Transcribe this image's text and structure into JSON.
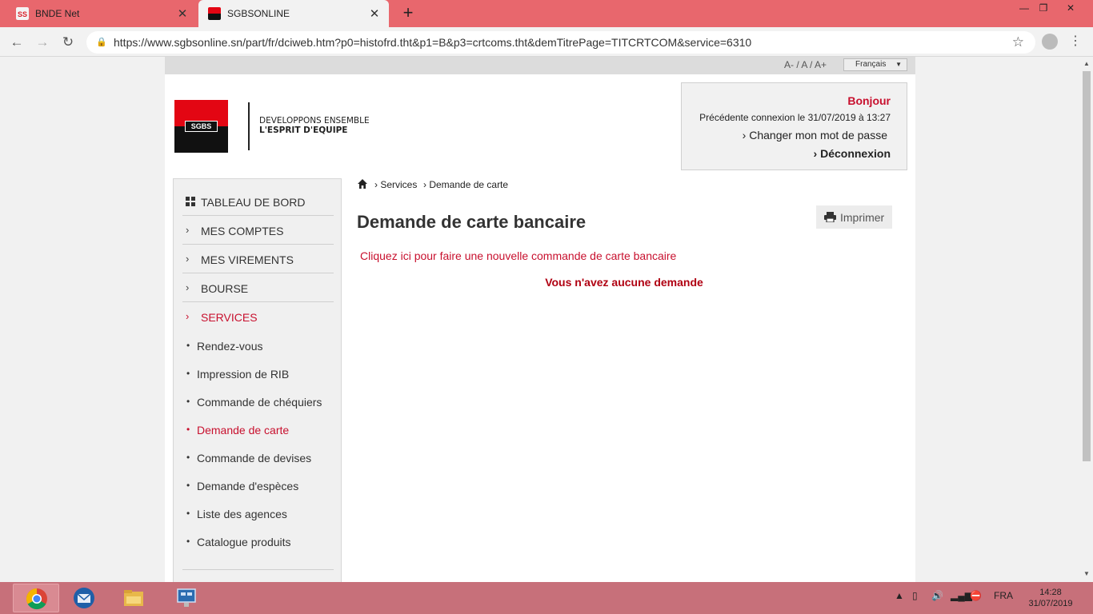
{
  "browser": {
    "tabs": [
      {
        "title": "BNDE Net",
        "icon": "bnde-favicon",
        "active": false
      },
      {
        "title": "SGBSONLINE",
        "icon": "sgbs-favicon",
        "active": true
      }
    ],
    "url": "https://www.sgbsonline.sn/part/fr/dciweb.htm?p0=histofrd.tht&p1=B&p3=crtcoms.tht&demTitrePage=TITCRTCOM&service=6310"
  },
  "header": {
    "font_size_controls": "A- / A / A+",
    "language": "Français",
    "logo_text": "SGBS",
    "slogan_line1": "DEVELOPPONS ENSEMBLE",
    "slogan_line2": "L'ESPRIT D'EQUIPE"
  },
  "user": {
    "greeting": "Bonjour",
    "last_login": "Précédente connexion  le 31/07/2019 à 13:27",
    "change_password": "Changer mon mot de passe",
    "logout": "Déconnexion"
  },
  "sidebar": {
    "items": [
      {
        "label": "TABLEAU DE BORD",
        "icon": "dashboard-icon"
      },
      {
        "label": "MES COMPTES"
      },
      {
        "label": "MES VIREMENTS"
      },
      {
        "label": "BOURSE"
      },
      {
        "label": "SERVICES",
        "active": true
      }
    ],
    "sub_items": [
      {
        "label": "Rendez-vous"
      },
      {
        "label": "Impression de RIB"
      },
      {
        "label": "Commande de chéquiers"
      },
      {
        "label": "Demande de carte",
        "active": true
      },
      {
        "label": "Commande de devises"
      },
      {
        "label": "Demande d'espèces"
      },
      {
        "label": "Liste des agences"
      },
      {
        "label": "Catalogue produits"
      }
    ]
  },
  "breadcrumb": {
    "items": [
      "Services",
      "Demande de carte"
    ]
  },
  "main": {
    "title": "Demande de carte bancaire",
    "print_label": "Imprimer",
    "new_order_link": "Cliquez ici pour faire une nouvelle commande de carte bancaire",
    "empty_message": "Vous n'avez aucune demande"
  },
  "taskbar": {
    "apps": [
      "chrome-icon",
      "thunderbird-icon",
      "file-explorer-icon",
      "network-app-icon"
    ],
    "language": "FRA",
    "time": "14:28",
    "date": "31/07/2019"
  },
  "colors": {
    "tab_bar": "#e8676d",
    "brand_red": "#c8102e",
    "logo_red": "#e30613",
    "taskbar": "#c7707a"
  }
}
